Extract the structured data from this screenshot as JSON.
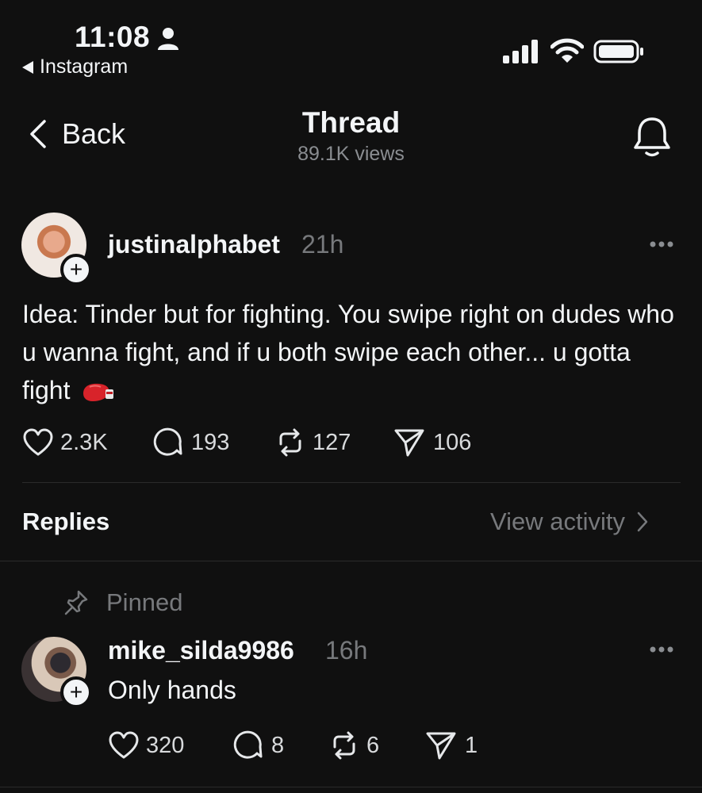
{
  "status_bar": {
    "time": "11:08",
    "back_app_label": "Instagram"
  },
  "nav": {
    "back_label": "Back",
    "title": "Thread",
    "views": "89.1K views"
  },
  "post": {
    "username": "justinalphabet",
    "time_ago": "21h",
    "text": "Idea: Tinder but for fighting. You swipe right on dudes who u wanna fight, and if u both swipe each other... u gotta fight",
    "emoji_icon": "boxing-glove-icon",
    "likes": "2.3K",
    "comments": "193",
    "reposts": "127",
    "shares": "106"
  },
  "replies_header": {
    "label": "Replies",
    "view_activity": "View activity"
  },
  "reply": {
    "pinned_label": "Pinned",
    "username": "mike_silda9986",
    "time_ago": "16h",
    "text": "Only hands",
    "likes": "320",
    "comments": "8",
    "reposts": "6",
    "shares": "1"
  },
  "colors": {
    "background": "#101010",
    "text_primary": "#f3f5f7",
    "text_secondary": "#77797c",
    "divider": "#2b2b2b"
  }
}
